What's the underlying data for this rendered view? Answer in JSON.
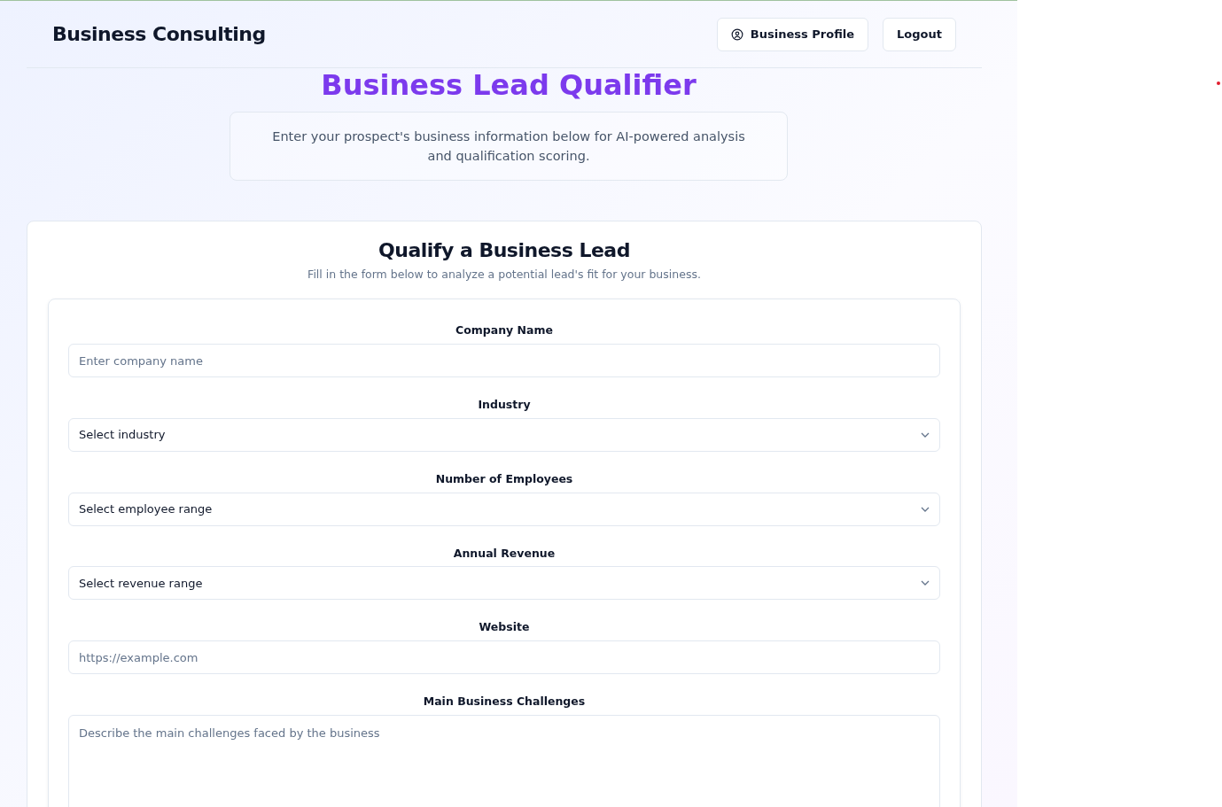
{
  "header": {
    "brand": "Business Consulting",
    "buttons": [
      {
        "label": "Business Profile",
        "kind": "profile"
      },
      {
        "label": "Logout",
        "kind": "plain"
      }
    ]
  },
  "hero": {
    "title": "Business Lead Qualifier",
    "description": "Enter your prospect's business information below for AI-powered analysis and qualification scoring."
  },
  "form": {
    "title": "Qualify a Business Lead",
    "subtitle": "Fill in the form below to analyze a potential lead's fit for your business.",
    "fields": [
      {
        "label": "Company Name",
        "kind": "text",
        "placeholder": "Enter company name"
      },
      {
        "label": "Industry",
        "kind": "select",
        "value": "Select industry"
      },
      {
        "label": "Number of Employees",
        "kind": "select",
        "value": "Select employee range"
      },
      {
        "label": "Annual Revenue",
        "kind": "select",
        "value": "Select revenue range"
      },
      {
        "label": "Website",
        "kind": "text",
        "placeholder": "https://example.com"
      },
      {
        "label": "Main Business Challenges",
        "kind": "textarea",
        "placeholder": "Describe the main challenges faced by the business"
      }
    ]
  }
}
